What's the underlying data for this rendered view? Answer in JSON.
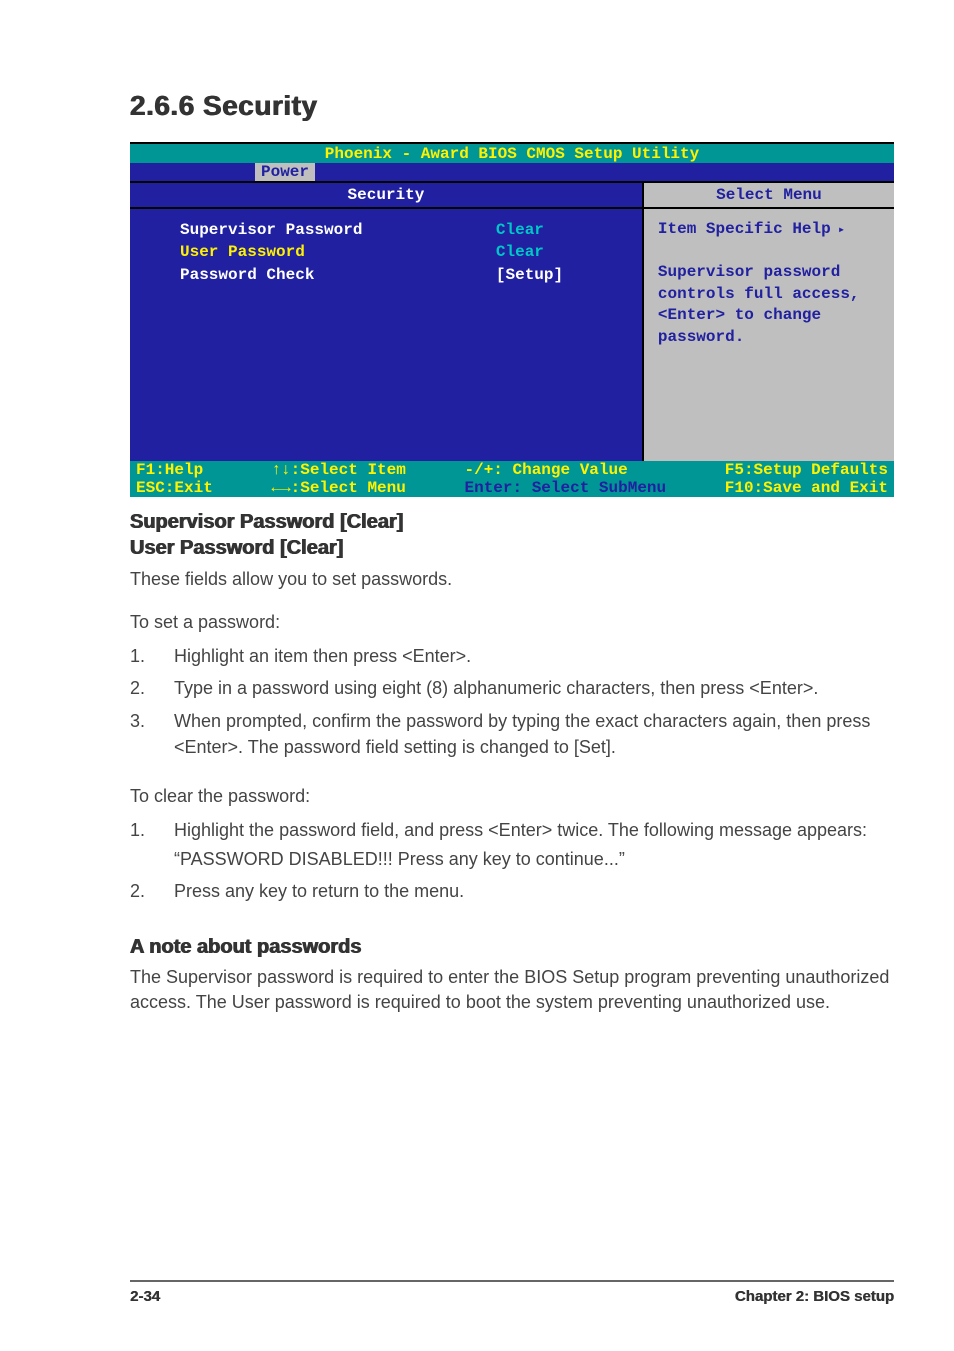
{
  "heading": "2.6.6   Security",
  "bios": {
    "title": "Phoenix - Award BIOS CMOS Setup Utility",
    "tab": "Power",
    "left_header": "Security",
    "right_header": "Select Menu",
    "rows": [
      {
        "label": "Supervisor Password",
        "value": "Clear",
        "val_class": "cyan"
      },
      {
        "label": "User Password",
        "value": "Clear",
        "val_class": "cyan"
      },
      {
        "label": "Password Check",
        "value": "[Setup]",
        "val_class": "white"
      }
    ],
    "help_title": "Item Specific Help",
    "help_body": "Supervisor password controls full access, <Enter> to change password.",
    "footer": {
      "c1a": "F1:Help",
      "c1b": "ESC:Exit",
      "c2a": "↑↓:Select Item",
      "c2b": "←→:Select Menu",
      "c3a": "-/+: Change Value",
      "c3b": "Enter: Select SubMenu",
      "c4a": "F5:Setup Defaults",
      "c4b": "F10:Save and Exit"
    }
  },
  "sub1": "Supervisor Password [Clear]",
  "sub2": "User Password [Clear]",
  "intro": "These fields allow you to set passwords.",
  "setpw_label": "To set a password:",
  "set_steps": {
    "s1": "Highlight an item then press <Enter>.",
    "s2": "Type in a password using eight (8) alphanumeric characters, then press <Enter>.",
    "s3": "When prompted, confirm the password by typing the exact characters again, then press <Enter>.  The password field setting is changed to [Set]."
  },
  "clearpw_label": "To clear the password:",
  "clear_steps": {
    "s1": "Highlight the password field, and press <Enter> twice. The following message appears:",
    "quote": "“PASSWORD DISABLED!!! Press any key to continue...”",
    "s2": "Press any key to return to the menu."
  },
  "note_heading": "A note about passwords",
  "note_body": "The Supervisor password is required to enter the BIOS Setup program preventing unauthorized access. The User password is required to boot the system preventing unauthorized use.",
  "footer_left": "2-34",
  "footer_right": "Chapter 2: BIOS setup"
}
